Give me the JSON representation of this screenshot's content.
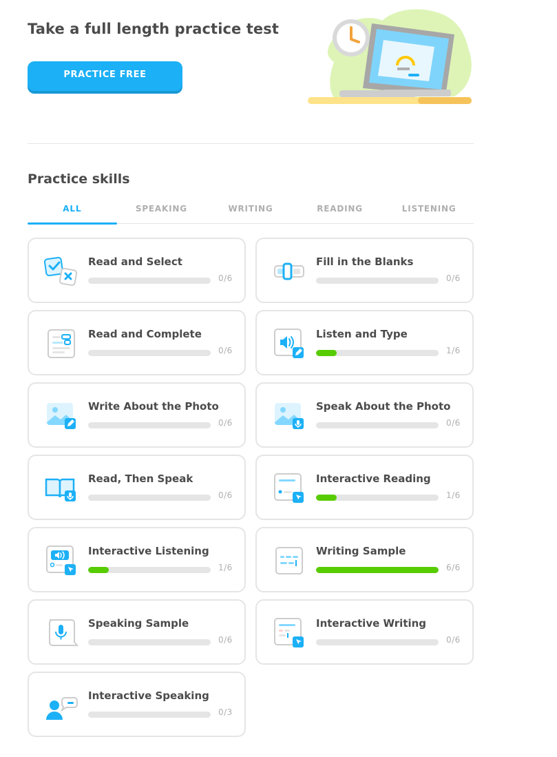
{
  "hero": {
    "title": "Take a full length practice test",
    "button_label": "PRACTICE FREE"
  },
  "skills_section": {
    "title": "Practice skills",
    "tabs": [
      {
        "label": "ALL",
        "active": true
      },
      {
        "label": "SPEAKING",
        "active": false
      },
      {
        "label": "WRITING",
        "active": false
      },
      {
        "label": "READING",
        "active": false
      },
      {
        "label": "LISTENING",
        "active": false
      }
    ],
    "cards": [
      {
        "id": "read-and-select",
        "title": "Read and Select",
        "done": 0,
        "total": 6,
        "count": "0/6",
        "icon": "checkbox-icon"
      },
      {
        "id": "fill-in-the-blanks",
        "title": "Fill in the Blanks",
        "done": 0,
        "total": 6,
        "count": "0/6",
        "icon": "blanks-icon"
      },
      {
        "id": "read-and-complete",
        "title": "Read and Complete",
        "done": 0,
        "total": 6,
        "count": "0/6",
        "icon": "document-icon"
      },
      {
        "id": "listen-and-type",
        "title": "Listen and Type",
        "done": 1,
        "total": 6,
        "count": "1/6",
        "icon": "speaker-pencil-icon"
      },
      {
        "id": "write-about-the-photo",
        "title": "Write About the Photo",
        "done": 0,
        "total": 6,
        "count": "0/6",
        "icon": "photo-pencil-icon"
      },
      {
        "id": "speak-about-the-photo",
        "title": "Speak About the Photo",
        "done": 0,
        "total": 6,
        "count": "0/6",
        "icon": "photo-mic-icon"
      },
      {
        "id": "read-then-speak",
        "title": "Read, Then Speak",
        "done": 0,
        "total": 6,
        "count": "0/6",
        "icon": "book-mic-icon"
      },
      {
        "id": "interactive-reading",
        "title": "Interactive Reading",
        "done": 1,
        "total": 6,
        "count": "1/6",
        "icon": "page-cursor-icon"
      },
      {
        "id": "interactive-listening",
        "title": "Interactive Listening",
        "done": 1,
        "total": 6,
        "count": "1/6",
        "icon": "speaker-cursor-icon"
      },
      {
        "id": "writing-sample",
        "title": "Writing Sample",
        "done": 6,
        "total": 6,
        "count": "6/6",
        "icon": "text-lines-icon"
      },
      {
        "id": "speaking-sample",
        "title": "Speaking Sample",
        "done": 0,
        "total": 6,
        "count": "0/6",
        "icon": "mic-bubble-icon"
      },
      {
        "id": "interactive-writing",
        "title": "Interactive Writing",
        "done": 0,
        "total": 6,
        "count": "0/6",
        "icon": "page-lines-cursor-icon"
      },
      {
        "id": "interactive-speaking",
        "title": "Interactive Speaking",
        "done": 0,
        "total": 3,
        "count": "0/3",
        "icon": "person-bubble-icon"
      }
    ]
  },
  "colors": {
    "accent": "#1cb0f6",
    "progress": "#58cc02",
    "track": "#e5e5e5",
    "border": "#e5e5e5"
  }
}
